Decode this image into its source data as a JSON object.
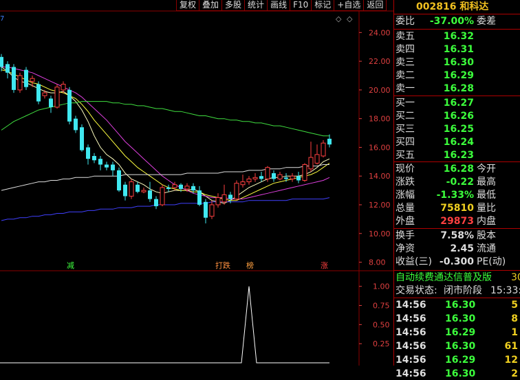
{
  "toolbar": {
    "buttons": [
      "复权",
      "叠加",
      "多股",
      "统计",
      "画线",
      "F10",
      "标记",
      "+自选",
      "返回"
    ]
  },
  "chart_data": {
    "type": "candlestick",
    "y_ticks": [
      "24.00",
      "22.00",
      "20.00",
      "18.00",
      "16.00",
      "14.00",
      "12.00",
      "10.00",
      "8.00"
    ],
    "ylim": [
      7.5,
      25.5
    ],
    "candles": [
      {
        "o": 22.3,
        "c": 21.6,
        "h": 22.5,
        "l": 21.3
      },
      {
        "o": 21.8,
        "c": 21.2,
        "h": 22.0,
        "l": 20.8
      },
      {
        "o": 21.6,
        "c": 20.0,
        "h": 21.8,
        "l": 19.8
      },
      {
        "o": 20.0,
        "c": 21.0,
        "h": 21.2,
        "l": 19.8
      },
      {
        "o": 21.4,
        "c": 20.2,
        "h": 21.6,
        "l": 20.0
      },
      {
        "o": 20.6,
        "c": 20.8,
        "h": 21.0,
        "l": 20.2
      },
      {
        "o": 20.4,
        "c": 19.2,
        "h": 20.6,
        "l": 19.0
      },
      {
        "o": 19.6,
        "c": 19.8,
        "h": 20.0,
        "l": 19.4
      },
      {
        "o": 19.4,
        "c": 18.8,
        "h": 19.6,
        "l": 18.4
      },
      {
        "o": 18.8,
        "c": 20.2,
        "h": 20.4,
        "l": 18.7
      },
      {
        "o": 20.0,
        "c": 20.4,
        "h": 20.6,
        "l": 19.8
      },
      {
        "o": 20.0,
        "c": 17.8,
        "h": 20.2,
        "l": 17.6
      },
      {
        "o": 18.0,
        "c": 17.2,
        "h": 18.2,
        "l": 17.0
      },
      {
        "o": 17.4,
        "c": 15.8,
        "h": 17.6,
        "l": 15.7
      },
      {
        "o": 16.0,
        "c": 15.2,
        "h": 16.2,
        "l": 14.8
      },
      {
        "o": 15.4,
        "c": 15.1,
        "h": 15.6,
        "l": 14.9
      },
      {
        "o": 15.2,
        "c": 14.8,
        "h": 15.4,
        "l": 14.4
      },
      {
        "o": 14.8,
        "c": 14.6,
        "h": 15.0,
        "l": 14.4
      },
      {
        "o": 14.8,
        "c": 14.4,
        "h": 15.0,
        "l": 14.0
      },
      {
        "o": 14.4,
        "c": 13.0,
        "h": 14.6,
        "l": 12.9
      },
      {
        "o": 13.4,
        "c": 12.6,
        "h": 13.6,
        "l": 12.3
      },
      {
        "o": 12.6,
        "c": 13.6,
        "h": 13.8,
        "l": 12.4
      },
      {
        "o": 13.4,
        "c": 12.9,
        "h": 13.6,
        "l": 12.8
      },
      {
        "o": 12.9,
        "c": 13.0,
        "h": 13.2,
        "l": 12.8
      },
      {
        "o": 13.0,
        "c": 12.4,
        "h": 13.6,
        "l": 12.2
      },
      {
        "o": 12.4,
        "c": 11.9,
        "h": 12.6,
        "l": 11.7
      },
      {
        "o": 12.0,
        "c": 13.2,
        "h": 13.4,
        "l": 11.9
      },
      {
        "o": 13.2,
        "c": 13.1,
        "h": 13.4,
        "l": 12.9
      },
      {
        "o": 13.2,
        "c": 13.4,
        "h": 13.6,
        "l": 13.0
      },
      {
        "o": 13.4,
        "c": 13.1,
        "h": 13.5,
        "l": 12.9
      },
      {
        "o": 13.1,
        "c": 13.3,
        "h": 13.5,
        "l": 12.9
      },
      {
        "o": 13.3,
        "c": 13.0,
        "h": 13.5,
        "l": 12.8
      },
      {
        "o": 13.0,
        "c": 12.0,
        "h": 13.3,
        "l": 11.9
      },
      {
        "o": 12.2,
        "c": 11.1,
        "h": 12.4,
        "l": 10.7
      },
      {
        "o": 11.2,
        "c": 12.0,
        "h": 12.3,
        "l": 11.0
      },
      {
        "o": 12.0,
        "c": 12.5,
        "h": 12.8,
        "l": 11.8
      },
      {
        "o": 12.2,
        "c": 12.7,
        "h": 13.4,
        "l": 12.0
      },
      {
        "o": 12.7,
        "c": 12.4,
        "h": 12.9,
        "l": 12.1
      },
      {
        "o": 12.4,
        "c": 13.5,
        "h": 13.7,
        "l": 12.3
      },
      {
        "o": 13.4,
        "c": 13.6,
        "h": 14.1,
        "l": 13.2
      },
      {
        "o": 13.6,
        "c": 13.8,
        "h": 14.0,
        "l": 13.4
      },
      {
        "o": 13.8,
        "c": 13.9,
        "h": 14.2,
        "l": 13.6
      },
      {
        "o": 14.0,
        "c": 13.8,
        "h": 14.3,
        "l": 13.6
      },
      {
        "o": 13.8,
        "c": 14.6,
        "h": 14.7,
        "l": 13.6
      },
      {
        "o": 14.2,
        "c": 13.8,
        "h": 14.4,
        "l": 13.6
      },
      {
        "o": 13.8,
        "c": 14.1,
        "h": 14.3,
        "l": 13.7
      },
      {
        "o": 13.9,
        "c": 13.8,
        "h": 14.2,
        "l": 13.6
      },
      {
        "o": 13.8,
        "c": 14.0,
        "h": 14.2,
        "l": 13.6
      },
      {
        "o": 14.0,
        "c": 13.7,
        "h": 14.3,
        "l": 13.5
      },
      {
        "o": 13.7,
        "c": 14.8,
        "h": 14.9,
        "l": 13.6
      },
      {
        "o": 14.5,
        "c": 15.3,
        "h": 16.4,
        "l": 14.3
      },
      {
        "o": 14.9,
        "c": 15.5,
        "h": 16.2,
        "l": 14.8
      },
      {
        "o": 15.4,
        "c": 16.3,
        "h": 16.5,
        "l": 15.3
      },
      {
        "o": 16.6,
        "c": 16.2,
        "h": 16.9,
        "l": 16.0
      }
    ],
    "ma_lines": [
      {
        "name": "ma5",
        "color": "#ffffc0",
        "values": [
          21.6,
          21.3,
          20.9,
          20.6,
          20.5,
          20.3,
          20.1,
          19.9,
          19.8,
          19.8,
          19.9,
          19.6,
          19.2,
          18.6,
          17.8,
          16.8,
          16.0,
          15.5,
          15.2,
          14.8,
          14.2,
          13.8,
          13.6,
          13.4,
          13.1,
          12.9,
          12.8,
          12.9,
          13.0,
          13.0,
          13.0,
          13.1,
          12.9,
          12.6,
          12.3,
          12.2,
          12.1,
          12.3,
          12.6,
          12.9,
          13.2,
          13.4,
          13.6,
          13.8,
          13.9,
          13.9,
          14.0,
          14.0,
          14.0,
          14.1,
          14.3,
          14.6,
          15.0,
          15.2
        ]
      },
      {
        "name": "ma10",
        "color": "#ffff40",
        "values": [
          21.4,
          21.3,
          21.1,
          20.9,
          20.7,
          20.5,
          20.4,
          20.2,
          20.0,
          19.9,
          19.8,
          19.6,
          19.4,
          19.0,
          18.5,
          17.9,
          17.4,
          16.9,
          16.4,
          15.9,
          15.4,
          15.0,
          14.6,
          14.3,
          14.0,
          13.7,
          13.4,
          13.2,
          13.1,
          13.0,
          13.0,
          12.9,
          12.9,
          12.7,
          12.6,
          12.5,
          12.4,
          12.3,
          12.3,
          12.5,
          12.7,
          12.9,
          13.1,
          13.3,
          13.5,
          13.6,
          13.7,
          13.8,
          13.9,
          14.0,
          14.1,
          14.3,
          14.6,
          14.9
        ]
      },
      {
        "name": "ma20",
        "color": "#e040e0",
        "values": [
          21.6,
          21.6,
          21.5,
          21.4,
          21.3,
          21.2,
          21.0,
          20.8,
          20.6,
          20.4,
          20.2,
          20.0,
          19.8,
          19.5,
          19.1,
          18.7,
          18.3,
          17.9,
          17.4,
          16.9,
          16.4,
          16.0,
          15.6,
          15.2,
          14.8,
          14.4,
          14.0,
          13.7,
          13.4,
          13.2,
          13.0,
          12.8,
          12.7,
          12.6,
          12.5,
          12.5,
          12.5,
          12.4,
          12.4,
          12.4,
          12.5,
          12.6,
          12.7,
          12.8,
          12.9,
          13.0,
          13.1,
          13.2,
          13.3,
          13.4,
          13.5,
          13.6,
          13.7,
          13.9
        ]
      },
      {
        "name": "ma60",
        "color": "#40e040",
        "values": [
          17.2,
          17.5,
          17.8,
          18.0,
          18.2,
          18.4,
          18.6,
          18.7,
          18.8,
          18.9,
          19.0,
          19.1,
          19.1,
          19.2,
          19.2,
          19.2,
          19.2,
          19.2,
          19.1,
          19.1,
          19.0,
          19.0,
          18.9,
          18.9,
          18.8,
          18.7,
          18.7,
          18.6,
          18.5,
          18.5,
          18.4,
          18.3,
          18.2,
          18.2,
          18.1,
          18.0,
          18.0,
          17.9,
          17.9,
          17.8,
          17.8,
          17.7,
          17.7,
          17.6,
          17.5,
          17.5,
          17.4,
          17.3,
          17.2,
          17.1,
          17.0,
          16.9,
          16.8,
          16.8
        ]
      },
      {
        "name": "ma120",
        "color": "#e0e0e0",
        "values": [
          13.0,
          13.1,
          13.2,
          13.3,
          13.4,
          13.5,
          13.6,
          13.6,
          13.7,
          13.7,
          13.8,
          13.8,
          13.9,
          13.9,
          13.9,
          14.0,
          14.0,
          14.0,
          14.0,
          14.0,
          14.1,
          14.1,
          14.1,
          14.1,
          14.1,
          14.1,
          14.1,
          14.1,
          14.1,
          14.1,
          14.2,
          14.2,
          14.2,
          14.2,
          14.2,
          14.2,
          14.3,
          14.3,
          14.3,
          14.3,
          14.4,
          14.4,
          14.4,
          14.5,
          14.5,
          14.5,
          14.6,
          14.6,
          14.6,
          14.7,
          14.7,
          14.7,
          14.8,
          14.8
        ]
      },
      {
        "name": "ma250",
        "color": "#4040ff",
        "values": [
          10.9,
          11.0,
          11.0,
          11.1,
          11.1,
          11.2,
          11.2,
          11.3,
          11.3,
          11.4,
          11.4,
          11.5,
          11.5,
          11.5,
          11.6,
          11.6,
          11.7,
          11.7,
          11.7,
          11.8,
          11.8,
          11.8,
          11.9,
          11.9,
          11.9,
          12.0,
          12.0,
          12.0,
          12.0,
          12.1,
          12.1,
          12.1,
          12.1,
          12.1,
          12.2,
          12.2,
          12.2,
          12.2,
          12.2,
          12.2,
          12.3,
          12.3,
          12.3,
          12.3,
          12.3,
          12.3,
          12.3,
          12.4,
          12.4,
          12.4,
          12.4,
          12.4,
          12.4,
          12.5
        ]
      }
    ],
    "annotations": [
      {
        "candle": 11,
        "text": "减",
        "color": "#40ff40"
      },
      {
        "candle": 35,
        "text": "打跌",
        "color": "#ff9040"
      },
      {
        "candle": 40,
        "text": "榜",
        "color": "#ffa040"
      },
      {
        "candle": 52,
        "text": "涨",
        "color": "#ff4040"
      }
    ],
    "sub_chart": {
      "y_ticks": [
        "1.00",
        "0.75",
        "0.50",
        "0.25"
      ],
      "ylim": [
        0,
        1.15
      ],
      "values": [
        0,
        0,
        0,
        0,
        0,
        0,
        0,
        0,
        0,
        0,
        0,
        0,
        0,
        0,
        0,
        0,
        0,
        0,
        0,
        0,
        0,
        0,
        0,
        0,
        0,
        0,
        0,
        0,
        0,
        0,
        0,
        0,
        0,
        0,
        0,
        0,
        0,
        0,
        0,
        0,
        1,
        0,
        0,
        0,
        0,
        0,
        0,
        0,
        0,
        0,
        0,
        0,
        0,
        0
      ]
    }
  },
  "stock": {
    "code": "002816",
    "name": "和科达"
  },
  "ratio": {
    "label": "委比",
    "value": "-37.00%",
    "label2": "委差"
  },
  "asks": [
    {
      "label": "卖五",
      "price": "16.32"
    },
    {
      "label": "卖四",
      "price": "16.31"
    },
    {
      "label": "卖三",
      "price": "16.30"
    },
    {
      "label": "卖二",
      "price": "16.29"
    },
    {
      "label": "卖一",
      "price": "16.28"
    }
  ],
  "bids": [
    {
      "label": "买一",
      "price": "16.27"
    },
    {
      "label": "买二",
      "price": "16.26"
    },
    {
      "label": "买三",
      "price": "16.25"
    },
    {
      "label": "买四",
      "price": "16.24"
    },
    {
      "label": "买五",
      "price": "16.23"
    }
  ],
  "quote": [
    {
      "label": "现价",
      "value": "16.28",
      "color": "green",
      "label2": "今开"
    },
    {
      "label": "涨跌",
      "value": "-0.22",
      "color": "green",
      "label2": "最高"
    },
    {
      "label": "涨幅",
      "value": "-1.33%",
      "color": "green",
      "label2": "最低"
    },
    {
      "label": "总量",
      "value": "75810",
      "color": "yellow",
      "label2": "量比"
    },
    {
      "label": "外盘",
      "value": "29873",
      "color": "red",
      "label2": "内盘"
    }
  ],
  "fundamentals": [
    {
      "label": "换手",
      "value": "7.58%",
      "label2": "股本"
    },
    {
      "label": "净资",
      "value": "2.45",
      "label2": "流通"
    },
    {
      "label": "收益(三)",
      "value": "-0.300",
      "label2": "PE(动)"
    }
  ],
  "notice": "自动续费通达信普及版",
  "notice_tail": "30",
  "trade_status": {
    "label": "交易状态:",
    "value": "闭市阶段",
    "time": "15:33:"
  },
  "ticks": [
    {
      "time": "14:56",
      "price": "16.30",
      "vol": "5"
    },
    {
      "time": "14:56",
      "price": "16.30",
      "vol": "8"
    },
    {
      "time": "14:56",
      "price": "16.29",
      "vol": "1"
    },
    {
      "time": "14:56",
      "price": "16.30",
      "vol": "61"
    },
    {
      "time": "14:56",
      "price": "16.29",
      "vol": "12"
    },
    {
      "time": "14:56",
      "price": "16.30",
      "vol": "2"
    }
  ],
  "colors": {
    "up": "#ff4040",
    "down": "#40e8f0",
    "grid": "#8b0000"
  }
}
